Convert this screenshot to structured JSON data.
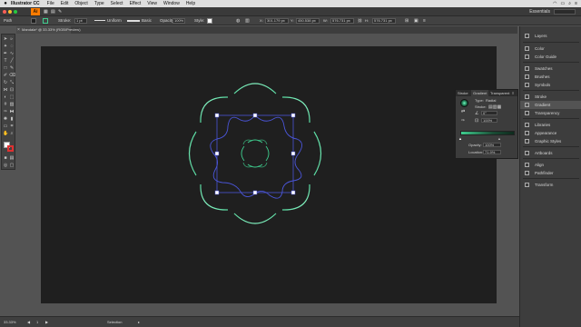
{
  "menubar": {
    "app_name": "Illustrator CC",
    "items": [
      "File",
      "Edit",
      "Object",
      "Type",
      "Select",
      "Effect",
      "View",
      "Window",
      "Help"
    ]
  },
  "appbar": {
    "logo": "Ai",
    "workspace": "Essentials"
  },
  "control": {
    "no_selection_label": "Path",
    "stroke_label": "Stroke:",
    "stroke_weight": "1 pt",
    "stroke_style": "Uniform",
    "brush_style": "Basic",
    "opacity_label": "Opacity:",
    "opacity_value": "100%",
    "style_label": "Style:",
    "x_value": "301.179 px",
    "y_value": "450.538 px",
    "w_value": "576.731 px",
    "h_value": "576.731 px"
  },
  "document": {
    "tab_title": "Mandala* @ 33.33% (RGB/Preview)"
  },
  "status": {
    "zoom": "33.33%",
    "page": "1",
    "tool": "Selection"
  },
  "gradient_panel": {
    "tabs": [
      "Stroke",
      "Gradient",
      "Transparent"
    ],
    "type_label": "Type:",
    "type_value": "Radial",
    "stroke_label": "Stroke:",
    "angle_value": "0°",
    "aspect_value": "100%",
    "opacity_label": "Opacity:",
    "opacity_value": "100%",
    "location_label": "Location:",
    "location_value": "71.9%"
  },
  "dock": {
    "items": [
      "Layers",
      "Color",
      "Color Guide",
      "Swatches",
      "Brushes",
      "Symbols",
      "Stroke",
      "Gradient",
      "Transparency",
      "Libraries",
      "Appearance",
      "Graphic Styles",
      "Artboards",
      "Align",
      "Pathfinder",
      "Transform"
    ],
    "active": "Gradient"
  },
  "colors": {
    "accent_green": "#3fce8f",
    "selection_blue": "#4a55d8",
    "artboard": "#1f1f1f",
    "app_orange": "#ff7c00"
  }
}
